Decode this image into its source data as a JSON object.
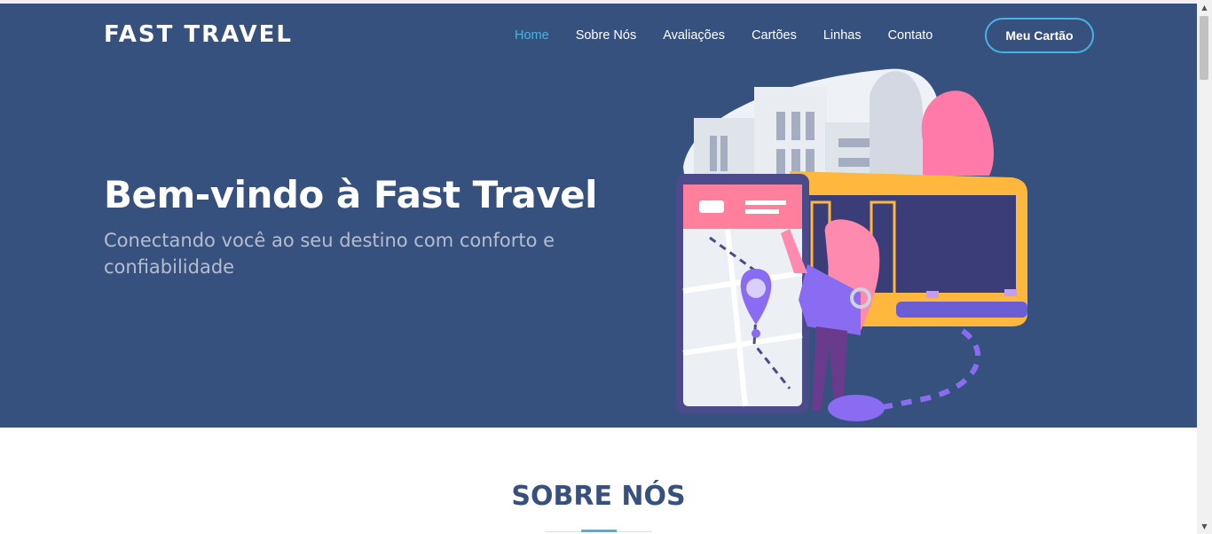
{
  "header": {
    "brand": "FAST TRAVEL",
    "nav": [
      "Home",
      "Sobre Nós",
      "Avaliações",
      "Cartões",
      "Linhas",
      "Contato"
    ],
    "active_nav": "Home",
    "cta_label": "Meu Cartão"
  },
  "hero": {
    "title": "Bem-vindo à Fast Travel",
    "subtitle": "Conectando você ao seu destino com conforto e confiabilidade"
  },
  "about": {
    "title": "SOBRE NÓS"
  },
  "colors": {
    "hero_bg": "#37517e",
    "accent": "#47b2e4",
    "bus": "#ffb83d",
    "pink": "#ff6f9c"
  }
}
